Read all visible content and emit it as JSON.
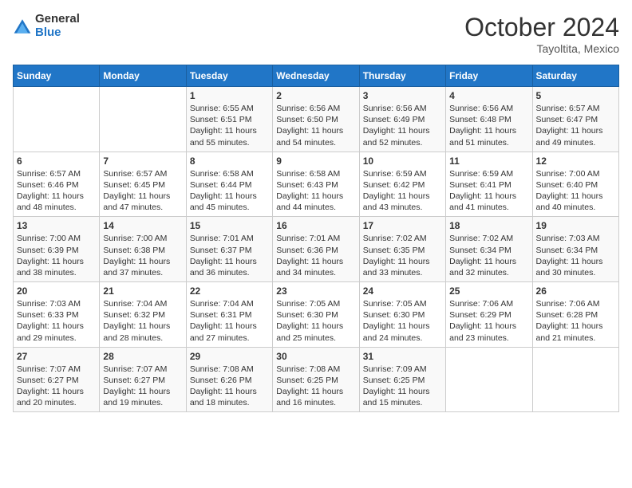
{
  "logo": {
    "general": "General",
    "blue": "Blue"
  },
  "title": "October 2024",
  "location": "Tayoltita, Mexico",
  "days_header": [
    "Sunday",
    "Monday",
    "Tuesday",
    "Wednesday",
    "Thursday",
    "Friday",
    "Saturday"
  ],
  "weeks": [
    [
      {
        "day": "",
        "content": ""
      },
      {
        "day": "",
        "content": ""
      },
      {
        "day": "1",
        "content": "Sunrise: 6:55 AM\nSunset: 6:51 PM\nDaylight: 11 hours and 55 minutes."
      },
      {
        "day": "2",
        "content": "Sunrise: 6:56 AM\nSunset: 6:50 PM\nDaylight: 11 hours and 54 minutes."
      },
      {
        "day": "3",
        "content": "Sunrise: 6:56 AM\nSunset: 6:49 PM\nDaylight: 11 hours and 52 minutes."
      },
      {
        "day": "4",
        "content": "Sunrise: 6:56 AM\nSunset: 6:48 PM\nDaylight: 11 hours and 51 minutes."
      },
      {
        "day": "5",
        "content": "Sunrise: 6:57 AM\nSunset: 6:47 PM\nDaylight: 11 hours and 49 minutes."
      }
    ],
    [
      {
        "day": "6",
        "content": "Sunrise: 6:57 AM\nSunset: 6:46 PM\nDaylight: 11 hours and 48 minutes."
      },
      {
        "day": "7",
        "content": "Sunrise: 6:57 AM\nSunset: 6:45 PM\nDaylight: 11 hours and 47 minutes."
      },
      {
        "day": "8",
        "content": "Sunrise: 6:58 AM\nSunset: 6:44 PM\nDaylight: 11 hours and 45 minutes."
      },
      {
        "day": "9",
        "content": "Sunrise: 6:58 AM\nSunset: 6:43 PM\nDaylight: 11 hours and 44 minutes."
      },
      {
        "day": "10",
        "content": "Sunrise: 6:59 AM\nSunset: 6:42 PM\nDaylight: 11 hours and 43 minutes."
      },
      {
        "day": "11",
        "content": "Sunrise: 6:59 AM\nSunset: 6:41 PM\nDaylight: 11 hours and 41 minutes."
      },
      {
        "day": "12",
        "content": "Sunrise: 7:00 AM\nSunset: 6:40 PM\nDaylight: 11 hours and 40 minutes."
      }
    ],
    [
      {
        "day": "13",
        "content": "Sunrise: 7:00 AM\nSunset: 6:39 PM\nDaylight: 11 hours and 38 minutes."
      },
      {
        "day": "14",
        "content": "Sunrise: 7:00 AM\nSunset: 6:38 PM\nDaylight: 11 hours and 37 minutes."
      },
      {
        "day": "15",
        "content": "Sunrise: 7:01 AM\nSunset: 6:37 PM\nDaylight: 11 hours and 36 minutes."
      },
      {
        "day": "16",
        "content": "Sunrise: 7:01 AM\nSunset: 6:36 PM\nDaylight: 11 hours and 34 minutes."
      },
      {
        "day": "17",
        "content": "Sunrise: 7:02 AM\nSunset: 6:35 PM\nDaylight: 11 hours and 33 minutes."
      },
      {
        "day": "18",
        "content": "Sunrise: 7:02 AM\nSunset: 6:34 PM\nDaylight: 11 hours and 32 minutes."
      },
      {
        "day": "19",
        "content": "Sunrise: 7:03 AM\nSunset: 6:34 PM\nDaylight: 11 hours and 30 minutes."
      }
    ],
    [
      {
        "day": "20",
        "content": "Sunrise: 7:03 AM\nSunset: 6:33 PM\nDaylight: 11 hours and 29 minutes."
      },
      {
        "day": "21",
        "content": "Sunrise: 7:04 AM\nSunset: 6:32 PM\nDaylight: 11 hours and 28 minutes."
      },
      {
        "day": "22",
        "content": "Sunrise: 7:04 AM\nSunset: 6:31 PM\nDaylight: 11 hours and 27 minutes."
      },
      {
        "day": "23",
        "content": "Sunrise: 7:05 AM\nSunset: 6:30 PM\nDaylight: 11 hours and 25 minutes."
      },
      {
        "day": "24",
        "content": "Sunrise: 7:05 AM\nSunset: 6:30 PM\nDaylight: 11 hours and 24 minutes."
      },
      {
        "day": "25",
        "content": "Sunrise: 7:06 AM\nSunset: 6:29 PM\nDaylight: 11 hours and 23 minutes."
      },
      {
        "day": "26",
        "content": "Sunrise: 7:06 AM\nSunset: 6:28 PM\nDaylight: 11 hours and 21 minutes."
      }
    ],
    [
      {
        "day": "27",
        "content": "Sunrise: 7:07 AM\nSunset: 6:27 PM\nDaylight: 11 hours and 20 minutes."
      },
      {
        "day": "28",
        "content": "Sunrise: 7:07 AM\nSunset: 6:27 PM\nDaylight: 11 hours and 19 minutes."
      },
      {
        "day": "29",
        "content": "Sunrise: 7:08 AM\nSunset: 6:26 PM\nDaylight: 11 hours and 18 minutes."
      },
      {
        "day": "30",
        "content": "Sunrise: 7:08 AM\nSunset: 6:25 PM\nDaylight: 11 hours and 16 minutes."
      },
      {
        "day": "31",
        "content": "Sunrise: 7:09 AM\nSunset: 6:25 PM\nDaylight: 11 hours and 15 minutes."
      },
      {
        "day": "",
        "content": ""
      },
      {
        "day": "",
        "content": ""
      }
    ]
  ]
}
